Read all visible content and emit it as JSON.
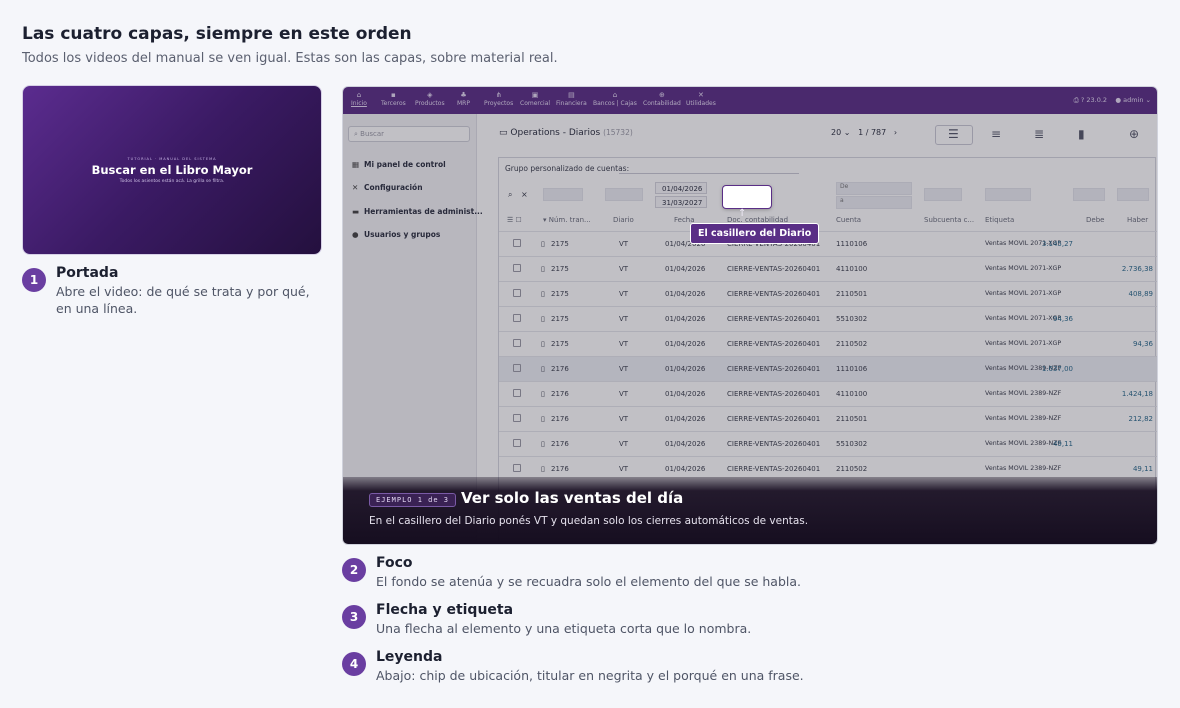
{
  "page": {
    "title": "Las cuatro capas, siempre en este orden",
    "subtitle": "Todos los videos del manual se ven igual. Estas son las capas, sobre material real."
  },
  "cover": {
    "kicker": "TUTORIAL · MANUAL DEL SISTEMA",
    "title": "Buscar en el Libro Mayor",
    "subtitle": "Todos los asientos están acá. La grilla se filtra."
  },
  "steps": [
    {
      "num": "1",
      "title": "Portada",
      "desc": "Abre el video: de qué se trata y por qué, en una línea."
    },
    {
      "num": "2",
      "title": "Foco",
      "desc": "El fondo se atenúa y se recuadra solo el elemento del que se habla."
    },
    {
      "num": "3",
      "title": "Flecha y etiqueta",
      "desc": "Una flecha al elemento y una etiqueta corta que lo nombra."
    },
    {
      "num": "4",
      "title": "Leyenda",
      "desc": "Abajo: chip de ubicación, titular en negrita y el porqué en una frase."
    }
  ],
  "screenshot": {
    "nav": [
      "Inicio",
      "Terceros",
      "Productos",
      "MRP",
      "Proyectos",
      "Comercial",
      "Financiera",
      "Bancos | Cajas",
      "Contabilidad",
      "Utilidades"
    ],
    "version": "23.0.2",
    "user": "admin",
    "sidebar": {
      "search_placeholder": "Buscar",
      "items": [
        "Mi panel de control",
        "Configuración",
        "Herramientas de administ...",
        "Usuarios y grupos"
      ]
    },
    "list_title": "Operations - Diarios",
    "list_count": "(15732)",
    "pager": {
      "per_page": "20",
      "page": "1",
      "total": "787"
    },
    "filter_label": "Grupo personalizado de cuentas:",
    "date_from": "01/04/2026",
    "date_to": "31/03/2027",
    "filter_de": "De",
    "filter_a": "a",
    "columns": [
      "Núm. tran...",
      "Diario",
      "Fecha",
      "Doc. contabilidad",
      "Cuenta",
      "Subcuenta c...",
      "Etiqueta",
      "Debe",
      "Haber"
    ],
    "rows": [
      {
        "num": "2175",
        "diario": "VT",
        "fecha": "01/04/2026",
        "doc": "CIERRE-VENTAS-20260401",
        "cuenta": "1110106",
        "etiqueta": "Ventas MOVIL 2071-XGP",
        "debe": "3.145,27",
        "haber": ""
      },
      {
        "num": "2175",
        "diario": "VT",
        "fecha": "01/04/2026",
        "doc": "CIERRE-VENTAS-20260401",
        "cuenta": "4110100",
        "etiqueta": "Ventas MOVIL 2071-XGP",
        "debe": "",
        "haber": "2.736,38"
      },
      {
        "num": "2175",
        "diario": "VT",
        "fecha": "01/04/2026",
        "doc": "CIERRE-VENTAS-20260401",
        "cuenta": "2110501",
        "etiqueta": "Ventas MOVIL 2071-XGP",
        "debe": "",
        "haber": "408,89"
      },
      {
        "num": "2175",
        "diario": "VT",
        "fecha": "01/04/2026",
        "doc": "CIERRE-VENTAS-20260401",
        "cuenta": "5510302",
        "etiqueta": "Ventas MOVIL 2071-XGP",
        "debe": "94,36",
        "haber": ""
      },
      {
        "num": "2175",
        "diario": "VT",
        "fecha": "01/04/2026",
        "doc": "CIERRE-VENTAS-20260401",
        "cuenta": "2110502",
        "etiqueta": "Ventas MOVIL 2071-XGP",
        "debe": "",
        "haber": "94,36"
      },
      {
        "num": "2176",
        "diario": "VT",
        "fecha": "01/04/2026",
        "doc": "CIERRE-VENTAS-20260401",
        "cuenta": "1110106",
        "etiqueta": "Ventas MOVIL 2389-NZF",
        "debe": "1.637,00",
        "haber": ""
      },
      {
        "num": "2176",
        "diario": "VT",
        "fecha": "01/04/2026",
        "doc": "CIERRE-VENTAS-20260401",
        "cuenta": "4110100",
        "etiqueta": "Ventas MOVIL 2389-NZF",
        "debe": "",
        "haber": "1.424,18"
      },
      {
        "num": "2176",
        "diario": "VT",
        "fecha": "01/04/2026",
        "doc": "CIERRE-VENTAS-20260401",
        "cuenta": "2110501",
        "etiqueta": "Ventas MOVIL 2389-NZF",
        "debe": "",
        "haber": "212,82"
      },
      {
        "num": "2176",
        "diario": "VT",
        "fecha": "01/04/2026",
        "doc": "CIERRE-VENTAS-20260401",
        "cuenta": "5510302",
        "etiqueta": "Ventas MOVIL 2389-NZF",
        "debe": "49,11",
        "haber": ""
      },
      {
        "num": "2176",
        "diario": "VT",
        "fecha": "01/04/2026",
        "doc": "CIERRE-VENTAS-20260401",
        "cuenta": "2110502",
        "etiqueta": "Ventas MOVIL 2389-NZF",
        "debe": "",
        "haber": "49,11"
      }
    ],
    "arrow_label": "El casillero del Diario",
    "caption": {
      "chip": "EJEMPLO 1 de 3",
      "title": "Ver solo las ventas del día",
      "desc": "En el casillero del Diario ponés VT y quedan solo los cierres automáticos de ventas."
    }
  }
}
